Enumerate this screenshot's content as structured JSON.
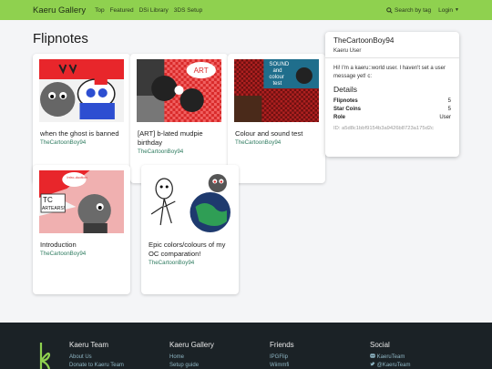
{
  "navbar": {
    "brand": "Kaeru Gallery",
    "links": [
      "Top",
      "Featured",
      "DSi Library",
      "3DS Setup"
    ],
    "search_label": "Search by tag",
    "login_label": "Login"
  },
  "main": {
    "title": "Flipnotes",
    "cards": [
      {
        "title": "when the ghost is banned",
        "author": "TheCartoonBoy94"
      },
      {
        "title": "[ART] b-lated mudpie birthday",
        "author": "TheCartoonBoy94"
      },
      {
        "title": "Colour and sound test",
        "author": "TheCartoonBoy94"
      },
      {
        "title": "Introduction",
        "author": "TheCartoonBoy94"
      },
      {
        "title": "Epic colors/colours of my OC comparation!",
        "author": "TheCartoonBoy94"
      }
    ]
  },
  "thumb_text": {
    "art": "ART",
    "sound": "SOUND",
    "and": "and",
    "colour": "colour",
    "test": "test",
    "intro_bubble": "Intro-duction",
    "intro_sign": "TC",
    "intro_sign2": "ARTEARS!"
  },
  "profile": {
    "name": "TheCartoonBoy94",
    "role": "Kaeru User",
    "message": "Hi! I'm a kaeru::world user. I haven't set a user message yet! c:",
    "details_heading": "Details",
    "details": [
      {
        "label": "Flipnotes",
        "value": "5"
      },
      {
        "label": "Star Coins",
        "value": "5"
      },
      {
        "label": "Role",
        "value": "User"
      }
    ],
    "id": "ID: a5d8c1bbf9154b3a9426b8723a175d2c"
  },
  "footer": {
    "columns": [
      {
        "heading": "Kaeru Team",
        "links": [
          "About Us",
          "Donate to Kaeru Team"
        ]
      },
      {
        "heading": "Kaeru Gallery",
        "links": [
          "Home",
          "Setup guide"
        ]
      },
      {
        "heading": "Friends",
        "links": [
          "IPGFlip",
          "Wiimmfi"
        ]
      },
      {
        "heading": "Social",
        "links": [
          "KaeruTeam",
          "@KaeruTeam"
        ]
      }
    ]
  },
  "colors": {
    "navbar": "#8fd14f",
    "footer": "#1b2226",
    "author_link": "#2c7a5e",
    "footer_link": "#8fb6c4"
  },
  "icons": [
    "search-icon",
    "discord-icon",
    "twitter-icon",
    "kaeru-logo"
  ]
}
